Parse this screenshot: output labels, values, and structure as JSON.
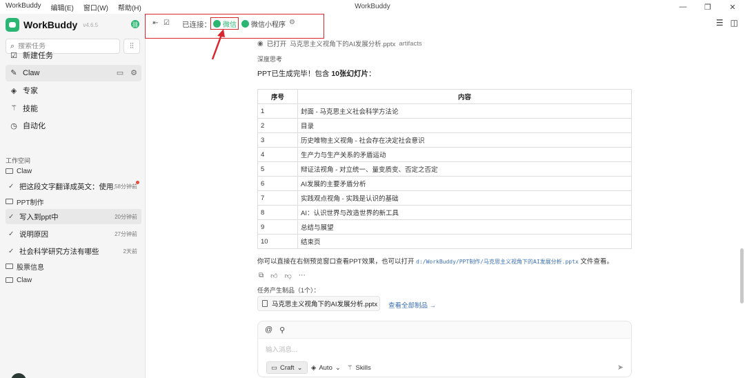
{
  "window": {
    "app_menu": [
      "WorkBuddy",
      "编辑(E)",
      "窗口(W)",
      "帮助(H)"
    ],
    "title": "WorkBuddy",
    "controls": [
      "—",
      "❐",
      "✕"
    ]
  },
  "sidebar": {
    "brand": "WorkBuddy",
    "version": "v4.6.5",
    "search_placeholder": "搜索任务",
    "nav": [
      {
        "label": "新建任务",
        "icon": "edit-square-icon"
      },
      {
        "label": "Claw",
        "icon": "paw-icon"
      },
      {
        "label": "专家",
        "icon": "graduation-cap-icon"
      },
      {
        "label": "技能",
        "icon": "magic-wand-icon"
      },
      {
        "label": "自动化",
        "icon": "clock-icon"
      }
    ],
    "workspace_label": "工作空间",
    "folders": [
      {
        "name": "Claw",
        "tasks": [
          {
            "title": "把这段文字翻译成英文：使用...",
            "time": "58分钟前",
            "unread": true
          }
        ]
      },
      {
        "name": "PPT制作",
        "tasks": [
          {
            "title": "写入到ppt中",
            "time": "20分钟前",
            "active": true
          },
          {
            "title": "说明原因",
            "time": "27分钟前"
          },
          {
            "title": "社会科学研究方法有哪些",
            "time": "2天前"
          }
        ]
      },
      {
        "name": "股票信息",
        "tasks": []
      },
      {
        "name": "Claw",
        "tasks": []
      }
    ]
  },
  "toolbar": {
    "connected_label": "已连接：",
    "wechat_label": "微信",
    "mini_program_label": "微信小程序",
    "highlight_color": "#d9262c",
    "accent_color": "#2bb673"
  },
  "chat": {
    "opened_prefix": "已打开",
    "opened_file": "马克思主义视角下的AI发展分析.pptx",
    "opened_tag": "artifacts",
    "thinking": "深度思考",
    "done_prefix": "PPT已生成完毕！包含 ",
    "done_count": "10张幻灯片",
    "done_suffix": "：",
    "table": {
      "headers": [
        "序号",
        "内容"
      ],
      "rows": [
        [
          "1",
          "封面 - 马克思主义社会科学方法论"
        ],
        [
          "2",
          "目录"
        ],
        [
          "3",
          "历史唯物主义视角 - 社会存在决定社会意识"
        ],
        [
          "4",
          "生产力与生产关系的矛盾运动"
        ],
        [
          "5",
          "辩证法视角 - 对立统一、量变质变、否定之否定"
        ],
        [
          "6",
          "AI发展的主要矛盾分析"
        ],
        [
          "7",
          "实践观点视角 - 实践是认识的基础"
        ],
        [
          "8",
          "AI：认识世界与改造世界的新工具"
        ],
        [
          "9",
          "总结与展望"
        ],
        [
          "10",
          "结束页"
        ]
      ]
    },
    "preview_prefix": "你可以直接在右侧预览窗口查看PPT效果，也可以打开 ",
    "preview_path": "d:/WorkBuddy/PPT制作/马克思主义视角下的AI发展分析.pptx",
    "preview_suffix": " 文件查看。",
    "artifacts_label": "任务产生制品（1个）：",
    "artifact_name": "马克思主义视角下的AI发展分析.pptx",
    "view_all": "查看全部制品 →"
  },
  "composer": {
    "placeholder": "输入消息...",
    "mode": "Craft",
    "model": "Auto",
    "skills": "Skills"
  }
}
